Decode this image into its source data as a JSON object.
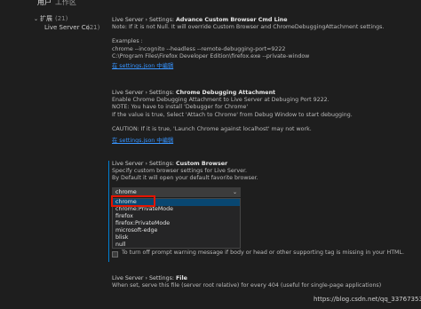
{
  "tabs": [
    {
      "label": "用户"
    },
    {
      "label": "工作区"
    }
  ],
  "tree": {
    "group_label": "扩展",
    "group_count": "(21)",
    "item_label": "Live Server Co...",
    "item_count": "(21)"
  },
  "settings": {
    "cmdline": {
      "title_prefix": "Live Server › Settings: ",
      "title_bold": "Advance Custom Browser Cmd Line",
      "lines": [
        "Note: If it is not Null. It will override Custom Browser and ChromeDebuggingAttachment settings.",
        "",
        "Examples :",
        "chrome --incognito --headless --remote-debugging-port=9222",
        "C:\\Program Files\\Firefox Developer Edition\\firefox.exe --private-window"
      ],
      "link": "在 settings.json 中编辑"
    },
    "debugging": {
      "title_prefix": "Live Server › Settings: ",
      "title_bold": "Chrome Debugging Attachment",
      "lines": [
        "Enable Chrome Debugging Attachment to Live Server at Debuging Port 9222.",
        "NOTE: You have to install 'Debugger for Chrome'",
        "If the value is true, Select 'Attach to Chrome' from Debug Window to start debugging.",
        "",
        "CAUTION: If it is true, 'Launch Chrome against localhost' may not work."
      ],
      "link": "在 settings.json 中编辑"
    },
    "custom_browser": {
      "title_prefix": "Live Server › Settings: ",
      "title_bold": "Custom Browser",
      "lines": [
        "Specify custom browser settings for Live Server.",
        "By Default it will open your default favorite browser."
      ],
      "select_value": "chrome",
      "options": [
        "chrome",
        "chrome:PrivateMode",
        "firefox",
        "firefox:PrivateMode",
        "microsoft-edge",
        "blisk",
        "null"
      ]
    },
    "no_prompt": {
      "label": "To turn off prompt warning message if body or head or other supporting tag is missing in your HTML."
    },
    "file": {
      "title_prefix": "Live Server › Settings: ",
      "title_bold": "File",
      "lines": [
        "When set, serve this file (server root relative) for every 404 (useful for single-page applications)"
      ]
    }
  },
  "watermark": "https://blog.csdn.net/qq_33767353",
  "colors": {
    "background": "#1e1e1e",
    "link": "#3794ff",
    "selected_option": "#094771",
    "highlight_box": "#e51400",
    "focus_bar": "#007fd4"
  }
}
